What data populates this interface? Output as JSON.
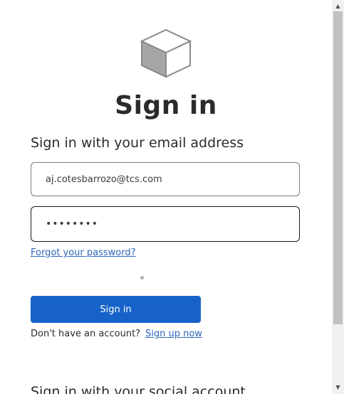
{
  "header": {
    "logo_icon": "cube-icon",
    "title": "Sign in"
  },
  "form": {
    "subtitle": "Sign in with your email address",
    "email_value": "aj.cotesbarrozo@tcs.com",
    "password_value": "••••••••",
    "forgot_password_label": "Forgot your password?",
    "sign_in_button_label": "Sign in",
    "no_account_text": "Don't have an account?",
    "sign_up_label": "Sign up now"
  },
  "social": {
    "heading": "Sign in with your social account"
  },
  "scrollbar": {
    "up_arrow": "▲",
    "down_arrow": "▼"
  },
  "colors": {
    "primary_button": "#1662c9",
    "link": "#2f67b8"
  }
}
